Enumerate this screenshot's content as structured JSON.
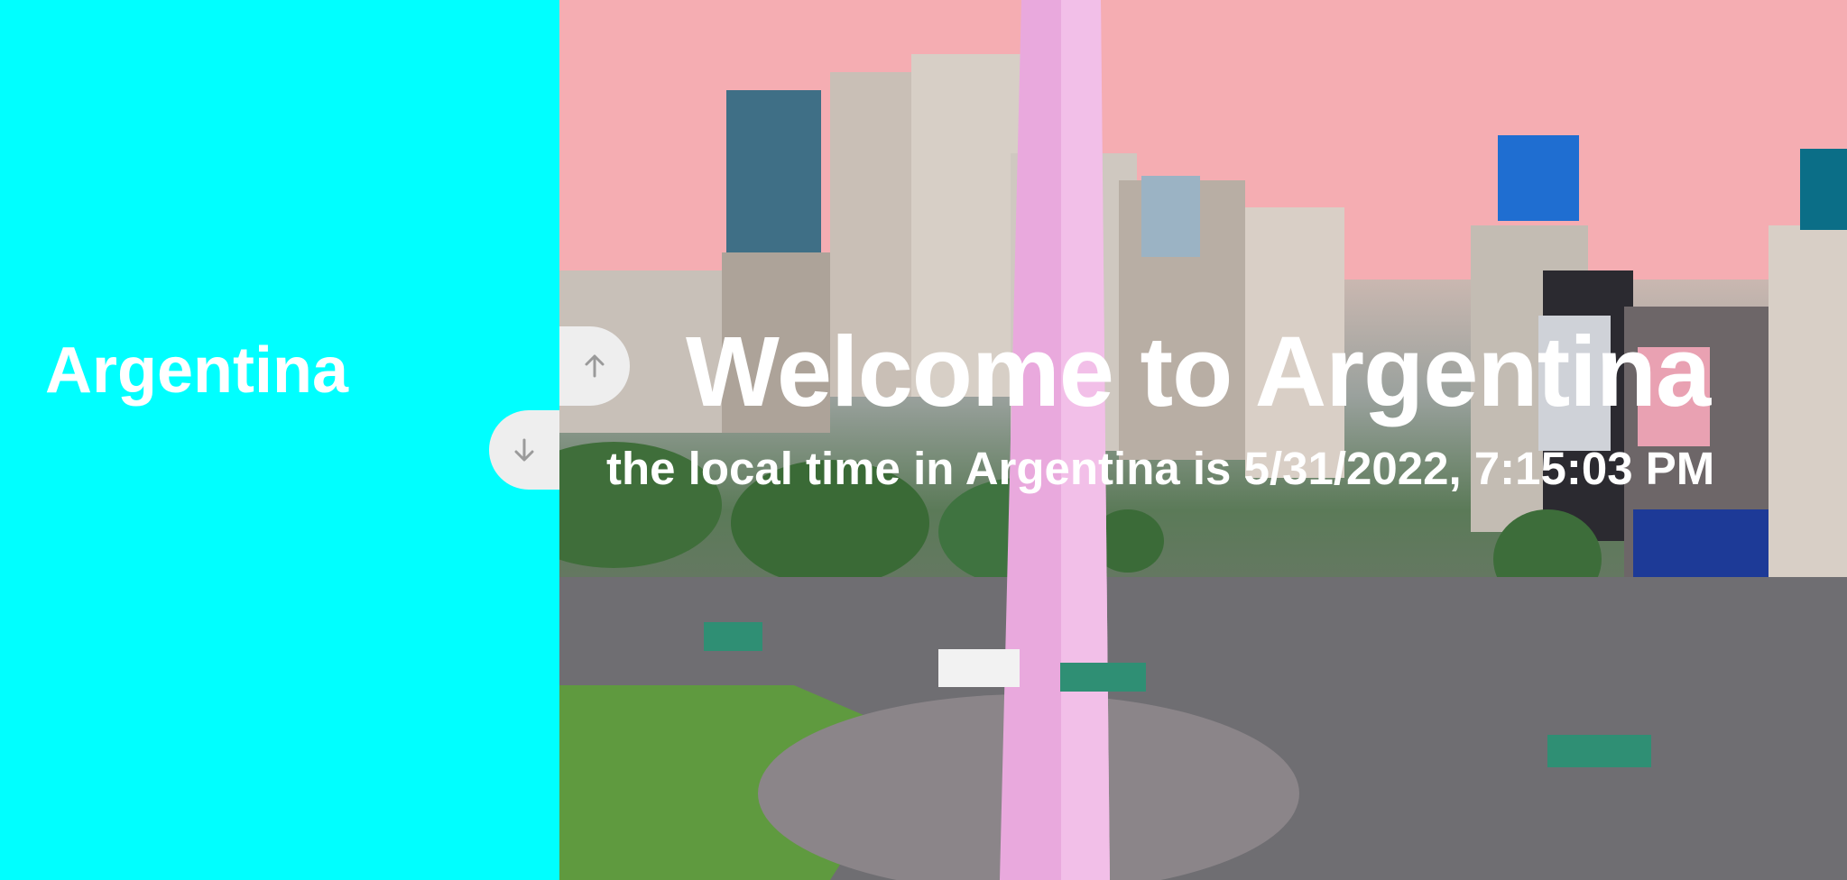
{
  "sidebar": {
    "title": "Argentina"
  },
  "hero": {
    "heading": "Welcome to Argentina",
    "local_time_text": "the local time in Argentina is 5/31/2022, 7:15:03 PM",
    "image_subject": "Buenos Aires Obelisco skyline at dusk"
  },
  "nav": {
    "up_icon": "arrow-up-icon",
    "down_icon": "arrow-down-icon"
  },
  "colors": {
    "sidebar_bg": "#00ffff",
    "text": "#ffffff",
    "nav_button_bg": "#eeeeee",
    "nav_icon": "#999999"
  }
}
